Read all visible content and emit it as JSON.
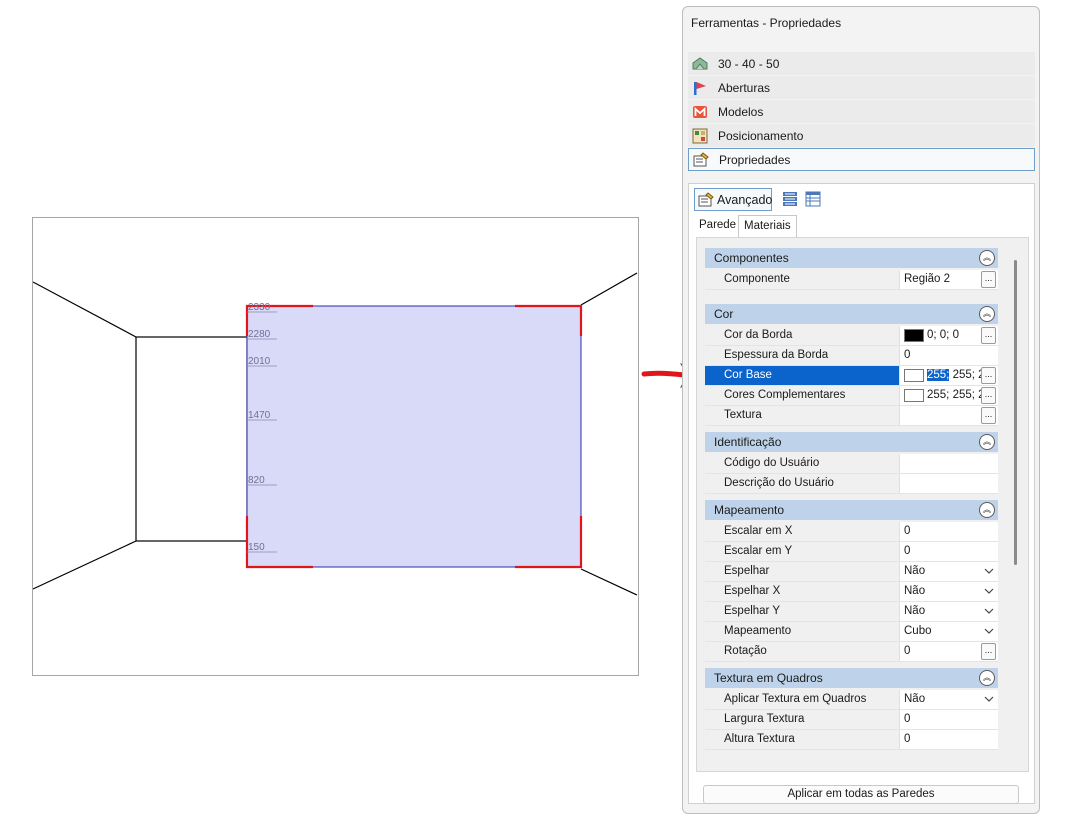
{
  "viewport": {
    "tick_labels": [
      "2330",
      "2280",
      "2010",
      "1470",
      "820",
      "150"
    ]
  },
  "panel": {
    "title": "Ferramentas - Propriedades",
    "tools": [
      {
        "label": "30 - 40 - 50",
        "icon": "house-icon"
      },
      {
        "label": "Aberturas",
        "icon": "window-flag-icon"
      },
      {
        "label": "Modelos",
        "icon": "m-logo-icon"
      },
      {
        "label": "Posicionamento",
        "icon": "grid-position-icon"
      },
      {
        "label": "Propriedades",
        "icon": "properties-icon",
        "active": true
      }
    ],
    "toolbar": {
      "advanced_label": "Avançado"
    },
    "tabs": [
      "Parede",
      "Materiais"
    ],
    "active_tab": "Materiais",
    "categories": {
      "componentes": "Componentes",
      "cor": "Cor",
      "identificacao": "Identificação",
      "mapeamento": "Mapeamento",
      "textura_quadros": "Textura em Quadros"
    },
    "props": {
      "componente": {
        "name": "Componente",
        "value": "Região 2"
      },
      "cor_borda": {
        "name": "Cor da Borda",
        "value": "0; 0; 0",
        "swatch": "#000000"
      },
      "espessura_borda": {
        "name": "Espessura da Borda",
        "value": "0"
      },
      "cor_base": {
        "name": "Cor Base",
        "value_hl": "255;",
        "value_rest": " 255; 2",
        "swatch": "#ffffff"
      },
      "cores_complementares": {
        "name": "Cores Complementares",
        "value": "255; 255; 2",
        "swatch": "#ffffff"
      },
      "textura": {
        "name": "Textura",
        "value": ""
      },
      "codigo_usuario": {
        "name": "Código do Usuário",
        "value": ""
      },
      "descricao_usuario": {
        "name": "Descrição do Usuário",
        "value": ""
      },
      "escalar_x": {
        "name": "Escalar em X",
        "value": "0"
      },
      "escalar_y": {
        "name": "Escalar em Y",
        "value": "0"
      },
      "espelhar": {
        "name": "Espelhar",
        "value": "Não"
      },
      "espelhar_x": {
        "name": "Espelhar X",
        "value": "Não"
      },
      "espelhar_y": {
        "name": "Espelhar Y",
        "value": "Não"
      },
      "mapeamento": {
        "name": "Mapeamento",
        "value": "Cubo"
      },
      "rotacao": {
        "name": "Rotação",
        "value": "0"
      },
      "aplicar_textura": {
        "name": "Aplicar Textura em Quadros",
        "value": "Não"
      },
      "largura_textura": {
        "name": "Largura Textura",
        "value": "0"
      },
      "altura_textura": {
        "name": "Altura Textura",
        "value": "0"
      }
    },
    "apply_button": "Aplicar em todas as Paredes"
  },
  "colors": {
    "wall_fill": "#d9d9f8",
    "wall_border": "#2b2bb0",
    "corner_marks": "#e0161d",
    "arrow": "#e0161d",
    "category_bg": "#bed3ea",
    "selection": "#0a64cc"
  }
}
